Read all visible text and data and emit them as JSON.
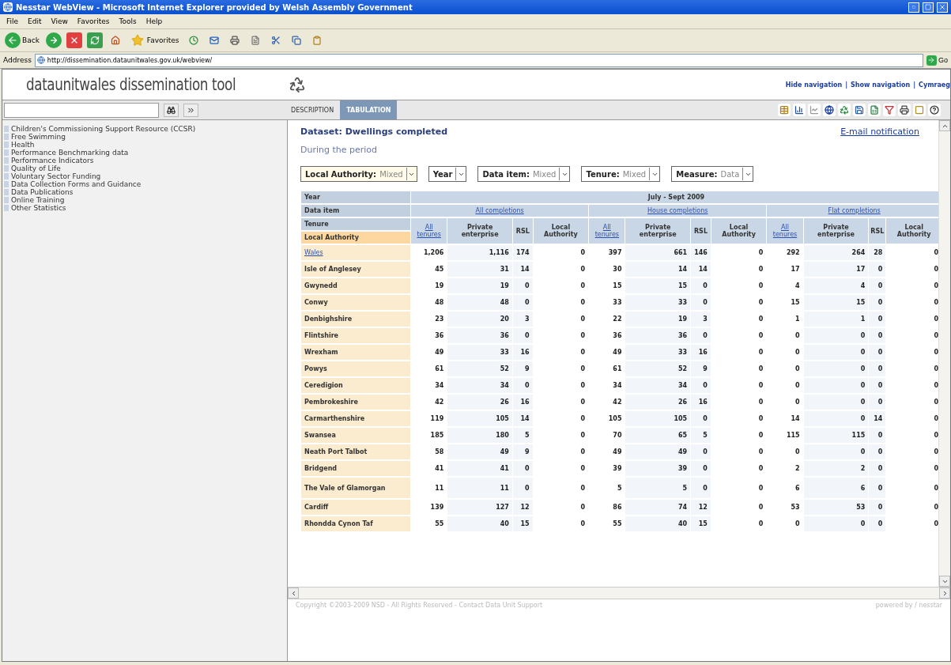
{
  "window": {
    "title": "Nesstar WebView - Microsoft Internet Explorer provided by Welsh Assembly Government"
  },
  "menu": [
    "File",
    "Edit",
    "View",
    "Favorites",
    "Tools",
    "Help"
  ],
  "toolbar": {
    "back": "Back",
    "favorites": "Favorites"
  },
  "address": {
    "label": "Address",
    "url": "http://dissemination.dataunitwales.gov.uk/webview/",
    "go": "Go"
  },
  "header": {
    "logo": "dataunitwales dissemination tool",
    "links": [
      "Hide navigation",
      "Show navigation",
      "Cymraeg"
    ],
    "separator": "|"
  },
  "tabs": [
    {
      "label": "DESCRIPTION",
      "selected": false
    },
    {
      "label": "TABULATION",
      "selected": true
    }
  ],
  "sidebar": {
    "items": [
      "Children's Commissioning Support Resource (CCSR)",
      "Free Swimming",
      "Health",
      "Performance Benchmarking data",
      "Performance Indicators",
      "Quality of Life",
      "Voluntary Sector Funding",
      "Data Collection Forms and Guidance",
      "Data Publications",
      "Online Training",
      "Other Statistics"
    ]
  },
  "dataset": {
    "title": "Dataset: Dwellings completed",
    "email": "E-mail notification",
    "subtitle": "During the period"
  },
  "filters": [
    {
      "label": "Local Authority:",
      "value": "Mixed"
    },
    {
      "label": "Year"
    },
    {
      "label": "Data item:",
      "value": "Mixed"
    },
    {
      "label": "Tenure:",
      "value": "Mixed"
    },
    {
      "label": "Measure:",
      "value": "Data"
    }
  ],
  "table": {
    "year_label": "Year",
    "year": "July - Sept 2009",
    "data_item_label": "Data item",
    "data_items": [
      "All completions",
      "House completions",
      "Flat completions"
    ],
    "tenure_label": "Tenure",
    "local_authority_label": "Local Authority",
    "tenures": [
      {
        "label": "All tenures",
        "link": true
      },
      {
        "label": "Private enterprise",
        "link": false
      },
      {
        "label": "RSL",
        "link": false
      },
      {
        "label": "Local Authority",
        "link": false
      },
      {
        "label": "All tenures",
        "link": true
      },
      {
        "label": "Private enterprise",
        "link": false
      },
      {
        "label": "RSL",
        "link": false
      },
      {
        "label": "Local Authority",
        "link": false
      },
      {
        "label": "All tenures",
        "link": true
      },
      {
        "label": "Private enterprise",
        "link": false
      },
      {
        "label": "RSL",
        "link": false
      },
      {
        "label": "Local Authority",
        "link": false
      }
    ],
    "rows": [
      {
        "name": "Wales",
        "link": true,
        "cells": [
          "1,206",
          "1,116",
          "174",
          "0",
          "397",
          "661",
          "146",
          "0",
          "292",
          "264",
          "28",
          "0"
        ]
      },
      {
        "name": "Isle of Anglesey",
        "link": false,
        "cells": [
          "45",
          "31",
          "14",
          "0",
          "30",
          "14",
          "14",
          "0",
          "17",
          "17",
          "0",
          "0"
        ]
      },
      {
        "name": "Gwynedd",
        "link": false,
        "cells": [
          "19",
          "19",
          "0",
          "0",
          "15",
          "15",
          "0",
          "0",
          "4",
          "4",
          "0",
          "0"
        ]
      },
      {
        "name": "Conwy",
        "link": false,
        "cells": [
          "48",
          "48",
          "0",
          "0",
          "33",
          "33",
          "0",
          "0",
          "15",
          "15",
          "0",
          "0"
        ]
      },
      {
        "name": "Denbighshire",
        "link": false,
        "cells": [
          "23",
          "20",
          "3",
          "0",
          "22",
          "19",
          "3",
          "0",
          "1",
          "1",
          "0",
          "0"
        ]
      },
      {
        "name": "Flintshire",
        "link": false,
        "cells": [
          "36",
          "36",
          "0",
          "0",
          "36",
          "36",
          "0",
          "0",
          "0",
          "0",
          "0",
          "0"
        ]
      },
      {
        "name": "Wrexham",
        "link": false,
        "cells": [
          "49",
          "33",
          "16",
          "0",
          "49",
          "33",
          "16",
          "0",
          "0",
          "0",
          "0",
          "0"
        ]
      },
      {
        "name": "Powys",
        "link": false,
        "cells": [
          "61",
          "52",
          "9",
          "0",
          "61",
          "52",
          "9",
          "0",
          "0",
          "0",
          "0",
          "0"
        ]
      },
      {
        "name": "Ceredigion",
        "link": false,
        "cells": [
          "34",
          "34",
          "0",
          "0",
          "34",
          "34",
          "0",
          "0",
          "0",
          "0",
          "0",
          "0"
        ]
      },
      {
        "name": "Pembrokeshire",
        "link": false,
        "cells": [
          "42",
          "26",
          "16",
          "0",
          "42",
          "26",
          "16",
          "0",
          "0",
          "0",
          "0",
          "0"
        ]
      },
      {
        "name": "Carmarthenshire",
        "link": false,
        "cells": [
          "119",
          "105",
          "14",
          "0",
          "105",
          "105",
          "0",
          "0",
          "14",
          "0",
          "14",
          "0"
        ]
      },
      {
        "name": "Swansea",
        "link": false,
        "cells": [
          "185",
          "180",
          "5",
          "0",
          "70",
          "65",
          "5",
          "0",
          "115",
          "115",
          "0",
          "0"
        ]
      },
      {
        "name": "Neath Port Talbot",
        "link": false,
        "cells": [
          "58",
          "49",
          "9",
          "0",
          "49",
          "49",
          "0",
          "0",
          "0",
          "0",
          "0",
          "0"
        ]
      },
      {
        "name": "Bridgend",
        "link": false,
        "cells": [
          "41",
          "41",
          "0",
          "0",
          "39",
          "39",
          "0",
          "0",
          "2",
          "2",
          "0",
          "0"
        ]
      },
      {
        "name": "The Vale of Glamorgan",
        "link": false,
        "cells": [
          "11",
          "11",
          "0",
          "0",
          "5",
          "5",
          "0",
          "0",
          "6",
          "6",
          "0",
          "0"
        ]
      },
      {
        "name": "Cardiff",
        "link": false,
        "cells": [
          "139",
          "127",
          "12",
          "0",
          "86",
          "74",
          "12",
          "0",
          "53",
          "53",
          "0",
          "0"
        ]
      },
      {
        "name": "Rhondda Cynon Taf",
        "link": false,
        "cells": [
          "55",
          "40",
          "15",
          "0",
          "55",
          "40",
          "15",
          "0",
          "0",
          "0",
          "0",
          "0"
        ]
      }
    ]
  },
  "footer": {
    "copyright": "Copyright ©2003-2009 NSD - All Rights Reserved - Contact Data Unit Support",
    "powered": "powered by / nesstar"
  }
}
